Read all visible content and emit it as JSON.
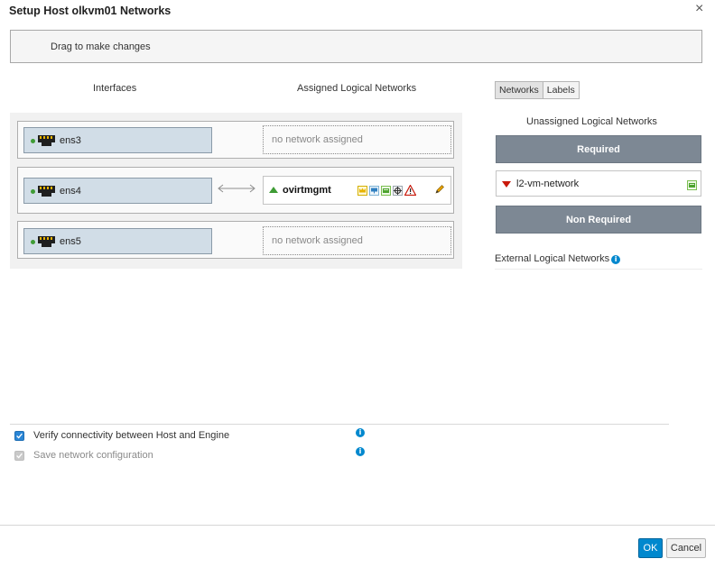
{
  "dialog": {
    "title": "Setup Host olkvm01 Networks",
    "close_glyph": "×",
    "hint": "Drag to make changes"
  },
  "columns": {
    "interfaces": "Interfaces",
    "assigned": "Assigned Logical Networks"
  },
  "interfaces": [
    {
      "name": "ens3",
      "status": "up",
      "assigned": "no network assigned"
    },
    {
      "name": "ens4",
      "status": "up",
      "network": "ovirtmgmt"
    },
    {
      "name": "ens5",
      "status": "up",
      "assigned": "no network assigned"
    }
  ],
  "assigned_network_icons": [
    "management-icon",
    "display-icon",
    "vm-icon",
    "migration-icon",
    "warning-icon",
    "edit-icon"
  ],
  "right_tabs": [
    "Networks",
    "Labels"
  ],
  "unassigned": {
    "heading": "Unassigned Logical Networks",
    "required_label": "Required",
    "required_networks": [
      {
        "name": "l2-vm-network",
        "status": "down",
        "icon": "vm-icon"
      }
    ],
    "non_required_label": "Non Required"
  },
  "external": {
    "heading": "External Logical Networks",
    "info_glyph": "i"
  },
  "options": {
    "verify": {
      "label": "Verify connectivity between Host and Engine",
      "checked": true,
      "enabled": true
    },
    "save": {
      "label": "Save network configuration",
      "checked": true,
      "enabled": false
    }
  },
  "footer": {
    "ok_label": "OK",
    "cancel_label": "Cancel"
  },
  "colors": {
    "nic_fill": "#d1dde7",
    "status_up": "#3f9c35",
    "status_down": "#c9190b",
    "section_bar": "#7d8894",
    "primary_button": "#0088ce"
  }
}
